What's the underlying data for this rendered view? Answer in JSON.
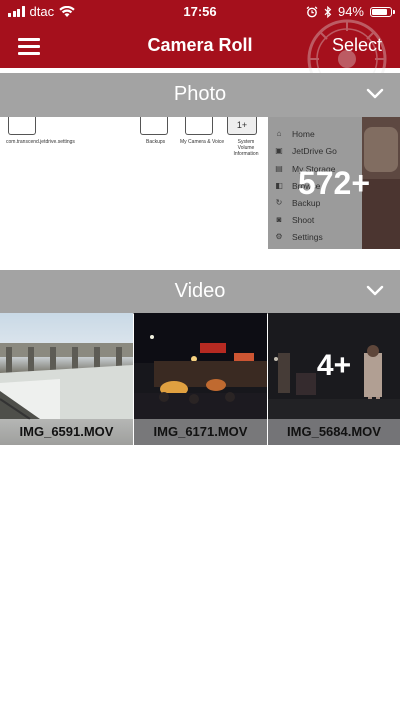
{
  "status_bar": {
    "carrier": "dtac",
    "time": "17:56",
    "battery_percent": "94%",
    "battery_level": 0.94,
    "icons": [
      "signal-bars-icon",
      "wifi-icon",
      "alarm-icon",
      "bluetooth-icon",
      "battery-icon"
    ]
  },
  "nav": {
    "title": "Camera Roll",
    "select_label": "Select",
    "menu_icon": "hamburger-menu-icon"
  },
  "sections": {
    "photo": {
      "title": "Photo",
      "count_label": "572+",
      "thumb1": {
        "labels": [
          "com.transcend.jetdrive.settings"
        ]
      },
      "thumb2": {
        "labels": [
          "Backups",
          "My Camera & Voice",
          "System Volume Information"
        ],
        "badge": "1+"
      },
      "thumb3_menu": [
        "Home",
        "JetDrive Go",
        "My Storage",
        "Browse",
        "Backup",
        "Shoot",
        "Settings"
      ]
    },
    "video": {
      "title": "Video",
      "items": [
        {
          "name": "IMG_6591.MOV"
        },
        {
          "name": "IMG_6171.MOV"
        },
        {
          "name": "IMG_5684.MOV"
        }
      ],
      "more_label": "4+"
    }
  },
  "colors": {
    "brand_red": "#a5101c",
    "section_gray": "#a3a3a3"
  }
}
